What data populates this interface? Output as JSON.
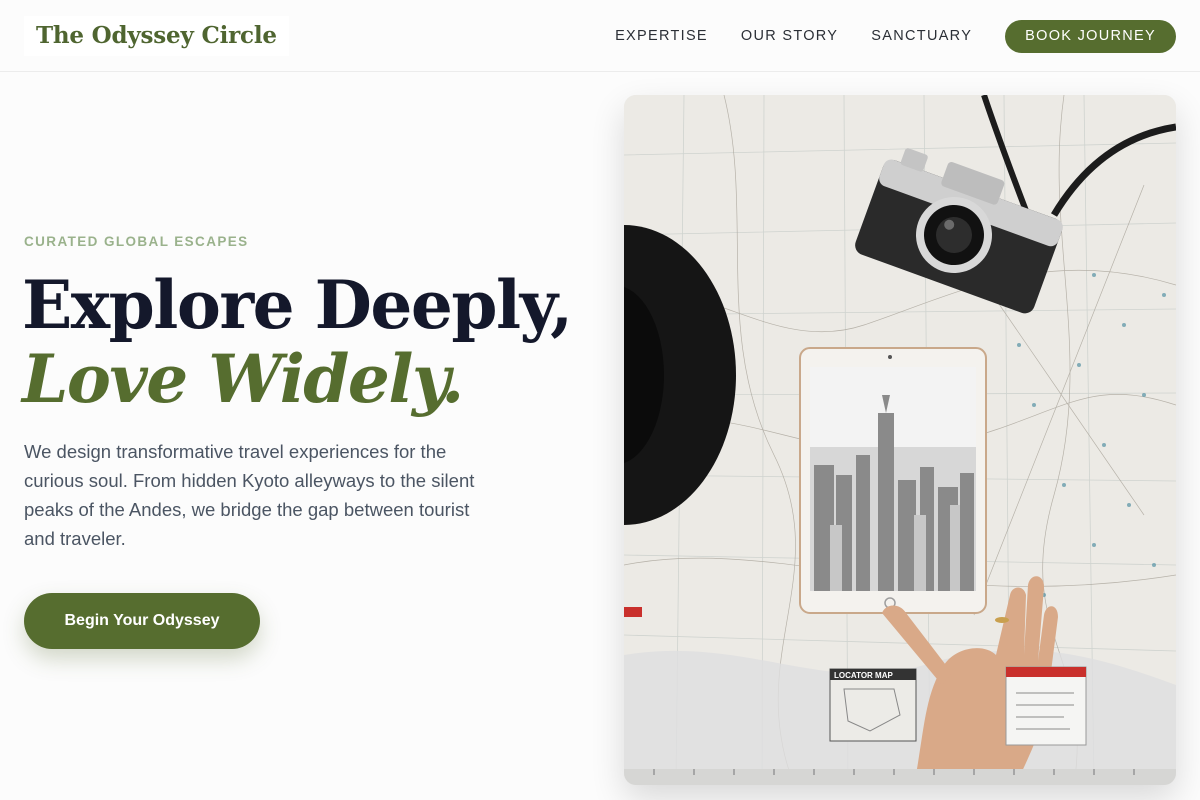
{
  "brand": {
    "name": "The Odyssey Circle"
  },
  "nav": {
    "items": [
      {
        "label": "EXPERTISE"
      },
      {
        "label": "OUR STORY"
      },
      {
        "label": "SANCTUARY"
      }
    ],
    "cta_label": "BOOK JOURNEY"
  },
  "hero": {
    "eyebrow": "CURATED GLOBAL ESCAPES",
    "title_line1": "Explore Deeply,",
    "title_line2": "Love Widely.",
    "description": "We design transformative travel experiences for the curious soul. From hidden Kyoto alleyways to the silent peaks of the Andes, we bridge the gap between tourist and traveler.",
    "cta_label": "Begin Your Odyssey",
    "image": {
      "subject": "map-camera-tablet-photo",
      "map_panel_label": "LOCATOR MAP"
    }
  },
  "colors": {
    "accent": "#566d2f",
    "eyebrow": "#9ab28c",
    "heading": "#14182b",
    "body_text": "#4b5563"
  }
}
